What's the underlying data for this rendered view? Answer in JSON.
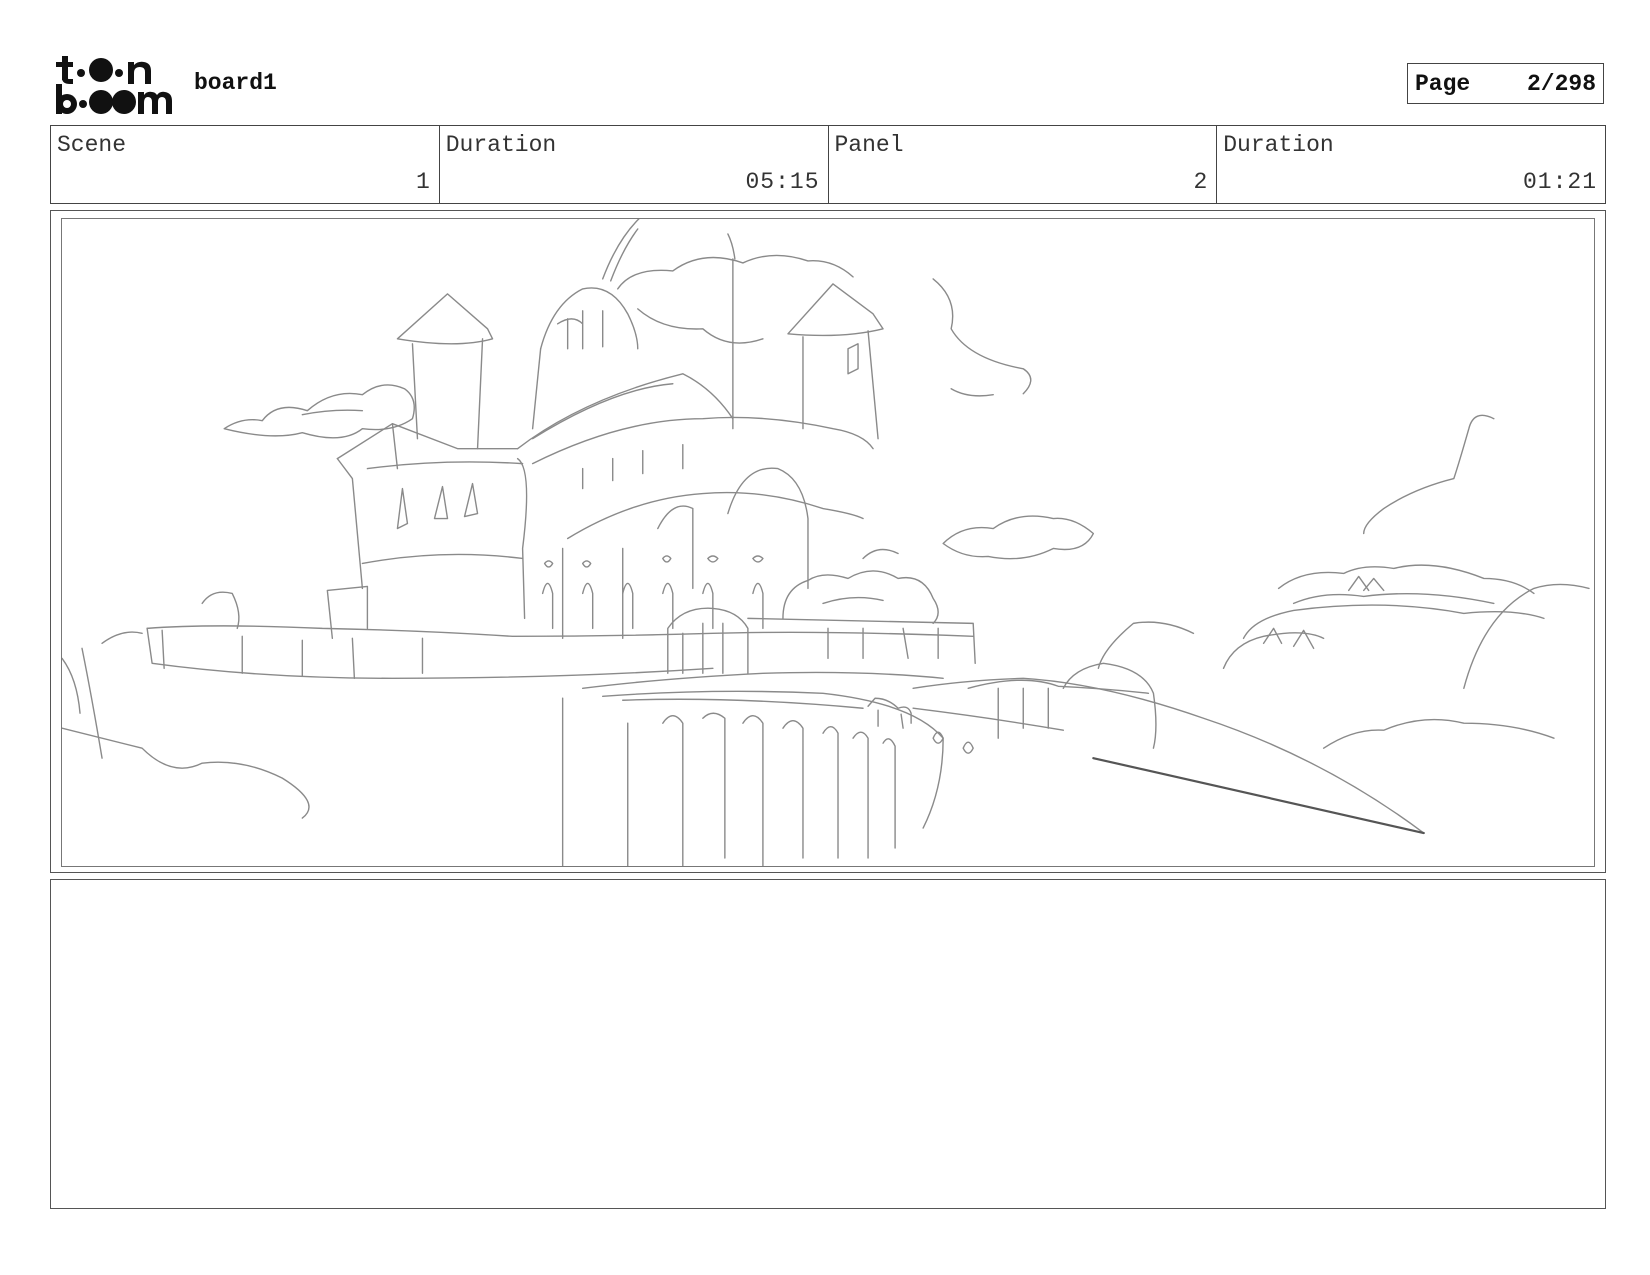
{
  "header": {
    "logo_top": "t o n",
    "logo_bottom": "b o m",
    "board_title": "board1",
    "page_label": "Page",
    "page_value": "2/298"
  },
  "info": {
    "scene_label": "Scene",
    "scene_value": "1",
    "scene_duration_label": "Duration",
    "scene_duration_value": "05:15",
    "panel_label": "Panel",
    "panel_value": "2",
    "panel_duration_label": "Duration",
    "panel_duration_value": "01:21"
  },
  "panel": {
    "sketch": "castle-landscape-sketch"
  },
  "notes": {
    "text": ""
  },
  "colors": {
    "border": "#444444",
    "sketch_stroke": "#8a8a8a"
  }
}
